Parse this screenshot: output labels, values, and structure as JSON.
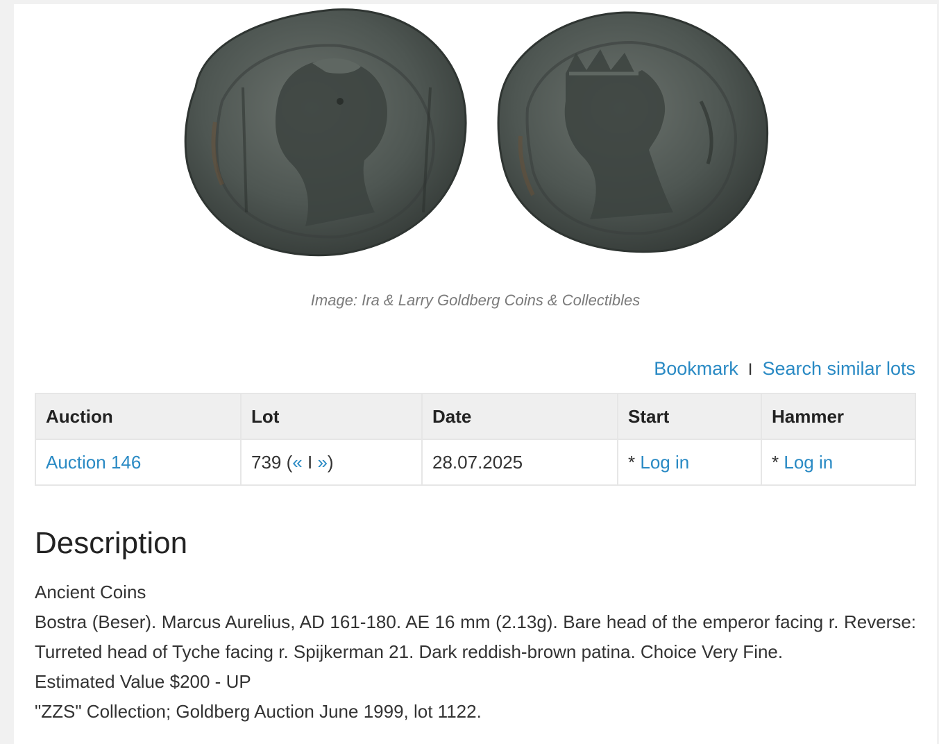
{
  "image": {
    "credit": "Image: Ira & Larry Goldberg Coins & Collectibles",
    "coin_colors": {
      "base": "#4e5652",
      "dark": "#2f3532",
      "light": "#7b837c",
      "rust": "#6a5036"
    }
  },
  "actions": {
    "bookmark": "Bookmark",
    "separator": "I",
    "search_similar": "Search similar lots"
  },
  "table": {
    "headers": {
      "auction": "Auction",
      "lot": "Lot",
      "date": "Date",
      "start": "Start",
      "hammer": "Hammer"
    },
    "row": {
      "auction": "Auction 146",
      "lot_number": "739",
      "lot_prev": "«",
      "lot_sep": "I",
      "lot_next": "»",
      "date": "28.07.2025",
      "start_prefix": "*",
      "start_link": "Log in",
      "hammer_prefix": "*",
      "hammer_link": "Log in"
    }
  },
  "description": {
    "title": "Description",
    "category": "Ancient Coins",
    "text": "Bostra (Beser). Marcus Aurelius, AD 161-180. AE 16 mm (2.13g). Bare head of the emperor facing r. Reverse: Turreted head of Tyche facing r. Spijkerman 21. Dark reddish-brown patina. Choice Very Fine.",
    "estimate": "Estimated Value $200 - UP",
    "provenance": "\"ZZS\" Collection; Goldberg Auction June 1999, lot 1122."
  },
  "colors": {
    "link": "#2a8ac4",
    "header_bg": "#efefef",
    "border": "#e6e6e6"
  }
}
